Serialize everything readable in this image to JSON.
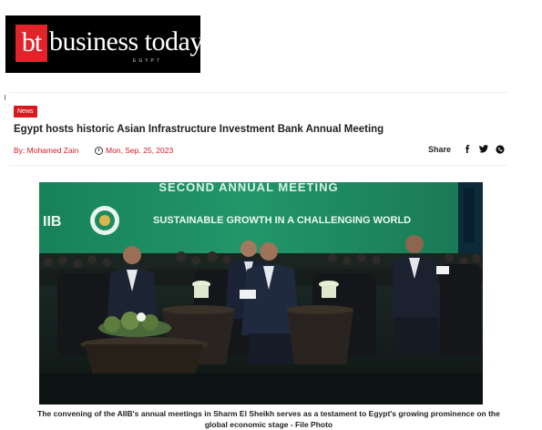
{
  "brand": {
    "mark": "bt",
    "name": "business today",
    "edition": "EGYPT"
  },
  "article": {
    "category": "News",
    "headline": "Egypt hosts historic Asian Infrastructure Investment Bank Annual Meeting",
    "author": "By: Mohamed Zain",
    "date": "Mon, Sep. 25, 2023",
    "share_label": "Share",
    "share_icons": [
      "facebook-icon",
      "twitter-icon",
      "whatsapp-icon"
    ]
  },
  "photo": {
    "banner_top": "SECOND ANNUAL MEETING",
    "banner_left": "IIB",
    "banner_text": "SUSTAINABLE GROWTH IN A CHALLENGING WORLD",
    "caption": "The convening of the AIIB's annual meetings in Sharm El Sheikh serves as a testament to Egypt's growing prominence on the global economic stage - File Photo"
  },
  "colors": {
    "brand_red": "#d71a21",
    "stage_green": "#1f8a5f"
  }
}
